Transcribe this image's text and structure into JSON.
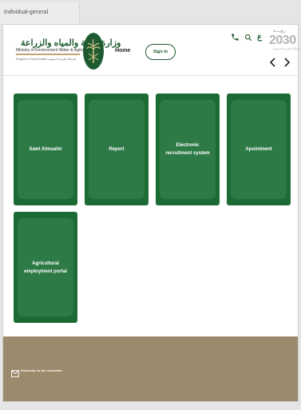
{
  "browser": {
    "tab_title": "Individual-general"
  },
  "header": {
    "logo": {
      "arabic": "وزارة البيئة والمياه والزراعة",
      "english": "Ministry of Environment Water & Agriculture",
      "subline": "Kingdom of Saudi Arabia  المملكة العربية السعودية"
    },
    "nav_home": "Home",
    "sign_in": "Sign In",
    "lang_toggle": "ع",
    "vision": {
      "top": "رؤيـــة",
      "number": "2030",
      "sub": "المملكة العربية السعودية"
    }
  },
  "cards": [
    {
      "label": "Sawt Almuatin"
    },
    {
      "label": "Report"
    },
    {
      "label": "Electronic recruitment system"
    },
    {
      "label": "Apointment"
    },
    {
      "label": "Agricultural employment portal"
    }
  ],
  "footer": {
    "newsletter": "Subscribe to the newsletter"
  },
  "colors": {
    "primary": "#1d6b34",
    "card_inner": "#2d7a47",
    "footer": "#9b8a6c"
  }
}
